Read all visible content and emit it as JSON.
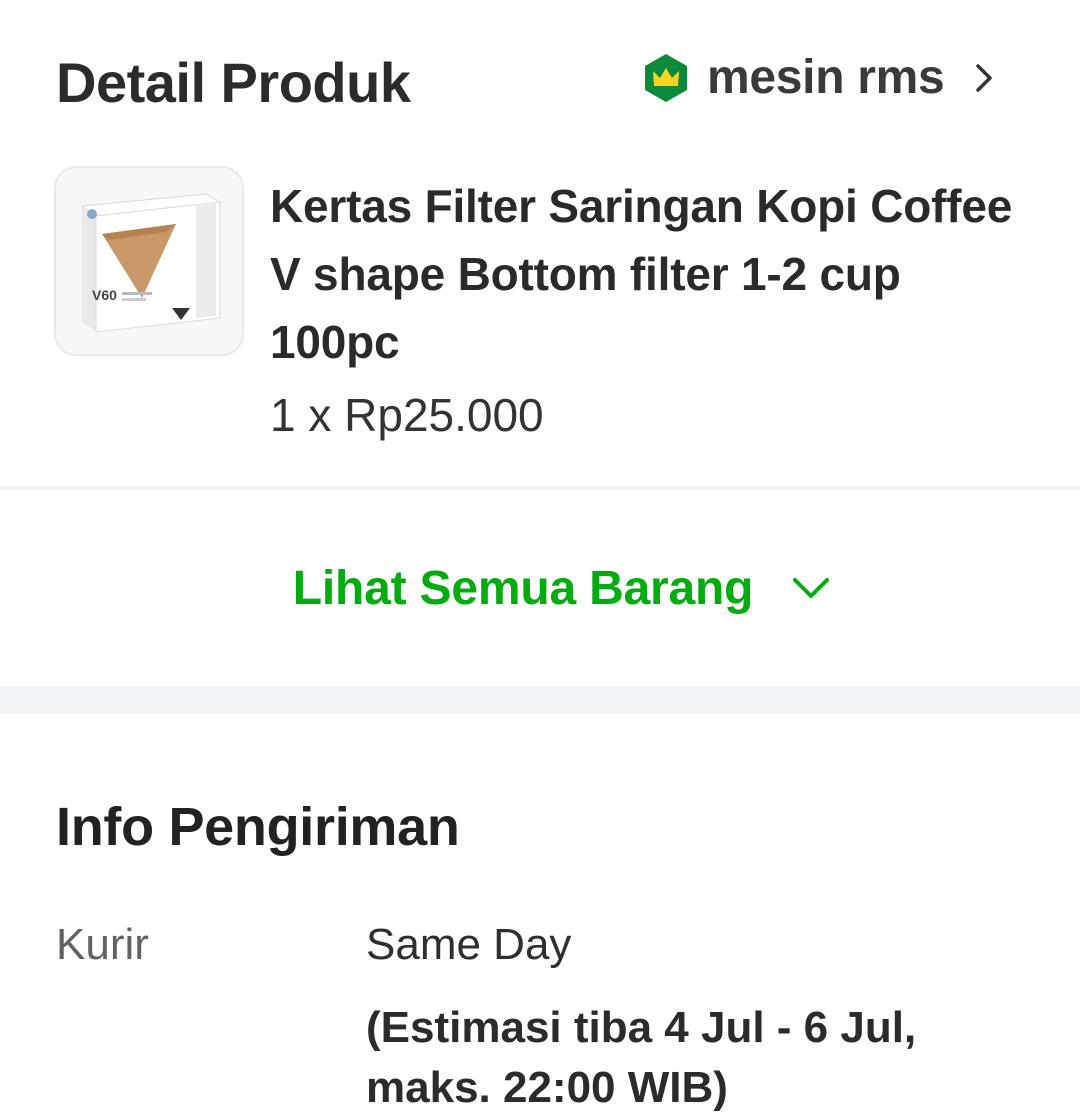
{
  "section_product": {
    "title": "Detail Produk",
    "seller": {
      "name": "mesin rms",
      "badge_icon": "power-merchant-crown-icon",
      "badge_color": "#0a8a3a"
    }
  },
  "product": {
    "name": "Kertas Filter Saringan Kopi Coffee V shape Bottom filter 1-2 cup 100pc",
    "price_line": "1 x Rp25.000",
    "thumbnail_text": "V60"
  },
  "see_all": {
    "label": "Lihat Semua Barang",
    "icon": "chevron-down-icon",
    "color": "#03ac0e"
  },
  "shipping": {
    "title": "Info Pengiriman",
    "courier_label": "Kurir",
    "courier_value": "Same Day",
    "estimate": "(Estimasi tiba 4 Jul - 6 Jul, maks. 22:00 WIB)"
  }
}
